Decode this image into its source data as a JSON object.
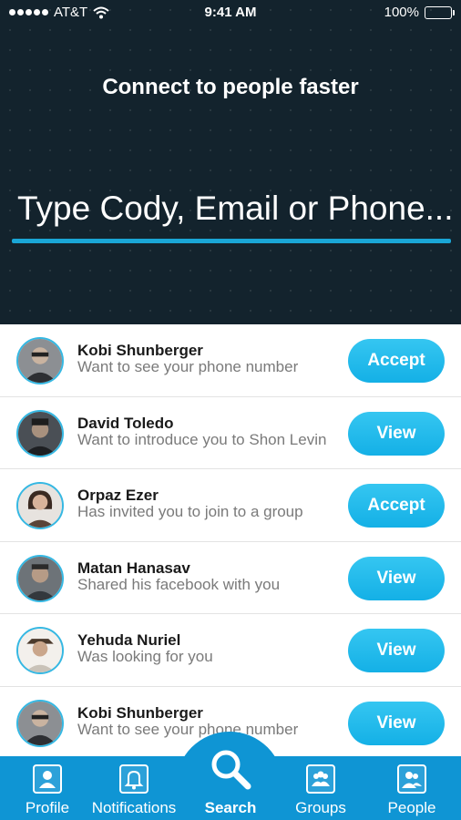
{
  "status_bar": {
    "carrier": "AT&T",
    "time": "9:41 AM",
    "battery": "100%"
  },
  "hero": {
    "title": "Connect to people faster",
    "search_placeholder": "Type Cody, Email or Phone..."
  },
  "requests": [
    {
      "name": "Kobi Shunberger",
      "message": "Want to see your phone number",
      "action": "Accept"
    },
    {
      "name": "David Toledo",
      "message": "Want to introduce you to Shon Levin",
      "action": "View"
    },
    {
      "name": "Orpaz Ezer",
      "message": "Has invited you to join to a group",
      "action": "Accept"
    },
    {
      "name": "Matan Hanasav",
      "message": "Shared his facebook with you",
      "action": "View"
    },
    {
      "name": "Yehuda Nuriel",
      "message": "Was looking for you",
      "action": "View"
    },
    {
      "name": "Kobi Shunberger",
      "message": "Want to see your phone number",
      "action": "View"
    }
  ],
  "tabs": [
    {
      "label": "Profile",
      "icon": "profile-icon"
    },
    {
      "label": "Notifications",
      "icon": "bell-icon"
    },
    {
      "label": "Search",
      "icon": "search-icon"
    },
    {
      "label": "Groups",
      "icon": "groups-icon"
    },
    {
      "label": "People",
      "icon": "people-icon"
    }
  ],
  "colors": {
    "accent": "#14b0e6",
    "tabbar": "#0f95d4",
    "hero_bg": "#13232d"
  }
}
